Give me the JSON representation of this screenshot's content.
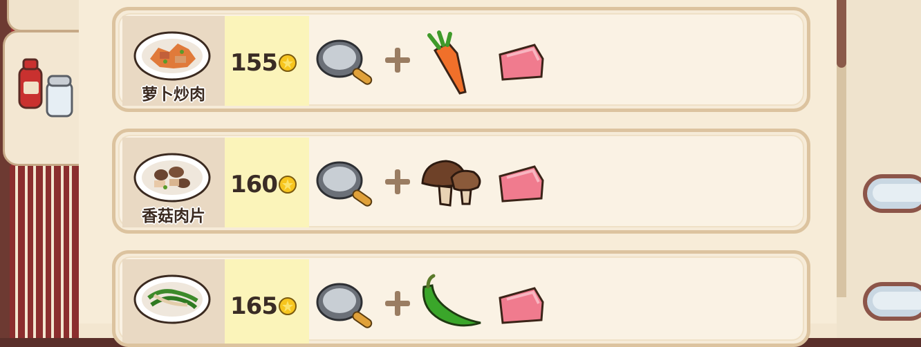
{
  "recipes": [
    {
      "name": "萝卜炒肉",
      "price": "155",
      "ingredient_icon": "carrot-icon"
    },
    {
      "name": "香菇肉片",
      "price": "160",
      "ingredient_icon": "mushroom-icon"
    },
    {
      "name": "",
      "price": "165",
      "ingredient_icon": "green-pepper-icon"
    }
  ],
  "colors": {
    "row_border": "#dcc39f",
    "price_bg": "#fbf4ba",
    "dish_bg": "#e9d9c3",
    "page_bg": "#f7ecd8",
    "binding": "#6d3a32"
  }
}
